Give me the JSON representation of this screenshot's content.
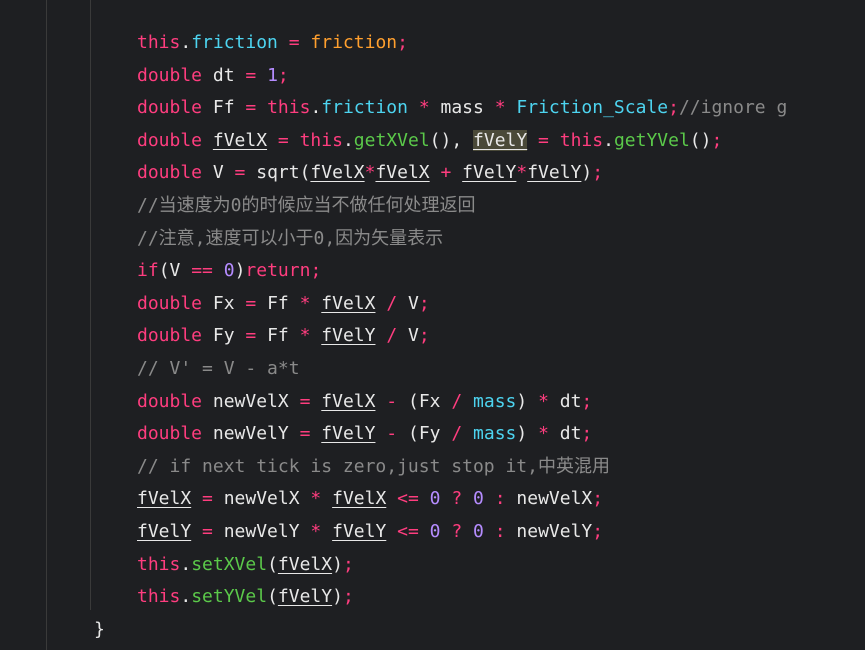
{
  "code": {
    "line1": [
      "this",
      ".",
      "friction",
      " = ",
      "friction",
      ";"
    ],
    "line2": [
      "double",
      " dt ",
      "=",
      " ",
      "1",
      ";"
    ],
    "line3": [
      "double",
      " Ff ",
      "=",
      " ",
      "this",
      ".",
      "friction",
      " ",
      "*",
      " mass ",
      "*",
      " ",
      "Friction_Scale",
      ";",
      "//ignore g"
    ],
    "line4": [
      "double",
      " ",
      "fVelX",
      " ",
      "=",
      " ",
      "this",
      ".",
      "getXVel",
      "(), ",
      "fVelY",
      " ",
      "=",
      " ",
      "this",
      ".",
      "getYVel",
      "()",
      ";"
    ],
    "line5": [
      "double",
      " V ",
      "=",
      " sqrt(",
      "fVelX",
      "*",
      "fVelX",
      " ",
      "+",
      " ",
      "fVelY",
      "*",
      "fVelY",
      ")",
      ";"
    ],
    "line6": [
      "//当速度为0的时候应当不做任何处理返回"
    ],
    "line7": [
      "//注意,速度可以小于0,因为矢量表示"
    ],
    "line8": [
      "if",
      "(V ",
      "==",
      " ",
      "0",
      ")",
      "return",
      ";"
    ],
    "line9": [
      "double",
      " Fx ",
      "=",
      " Ff ",
      "*",
      " ",
      "fVelX",
      " ",
      "/",
      " V",
      ";"
    ],
    "line10": [
      "double",
      " Fy ",
      "=",
      " Ff ",
      "*",
      " ",
      "fVelY",
      " ",
      "/",
      " V",
      ";"
    ],
    "line11": [
      "// V' = V - a*t"
    ],
    "line12": [
      "double",
      " newVelX ",
      "=",
      " ",
      "fVelX",
      " ",
      "-",
      " (Fx ",
      "/",
      " ",
      "mass",
      ") ",
      "*",
      " dt",
      ";"
    ],
    "line13": [
      "double",
      " newVelY ",
      "=",
      " ",
      "fVelY",
      " ",
      "-",
      " (Fy ",
      "/",
      " ",
      "mass",
      ") ",
      "*",
      " dt",
      ";"
    ],
    "line14": [
      "// if next tick is zero,just stop it,中英混用"
    ],
    "line15": [
      "fVelX",
      " ",
      "=",
      " newVelX ",
      "*",
      " ",
      "fVelX",
      " ",
      "<=",
      " ",
      "0",
      " ",
      "?",
      " ",
      "0",
      " ",
      ":",
      " newVelX",
      ";"
    ],
    "line16": [
      "fVelY",
      " ",
      "=",
      " newVelY ",
      "*",
      " ",
      "fVelY",
      " ",
      "<=",
      " ",
      "0",
      " ",
      "?",
      " ",
      "0",
      " ",
      ":",
      " newVelY",
      ";"
    ],
    "line17": [
      "this",
      ".",
      "setXVel",
      "(",
      "fVelX",
      ")",
      ";"
    ],
    "line18": [
      "this",
      ".",
      "setYVel",
      "(",
      "fVelY",
      ")",
      ";"
    ],
    "line19": [
      "}"
    ]
  },
  "colors": {
    "background": "#1e1f22",
    "keyword": "#ff3d7f",
    "function": "#5bc94a",
    "property": "#4dd4f0",
    "parameter": "#ff9f2e",
    "number": "#b58cff",
    "comment": "#8a8a8a",
    "identifier": "#e8e8e8",
    "highlight": "#4a4938"
  }
}
